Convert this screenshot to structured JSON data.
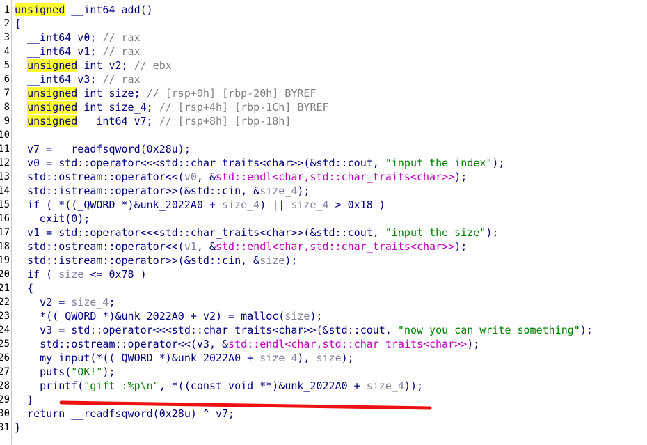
{
  "lines": [
    {
      "n": "1",
      "tokens": [
        {
          "t": "unsigned",
          "c": "t hl"
        },
        {
          "t": " __int64 add()",
          "c": "t"
        }
      ]
    },
    {
      "n": "2",
      "tokens": [
        {
          "t": "{",
          "c": "t"
        }
      ]
    },
    {
      "n": "3",
      "tokens": [
        {
          "t": "  __int64 v0; ",
          "c": "t"
        },
        {
          "t": "// rax",
          "c": "cm"
        }
      ]
    },
    {
      "n": "4",
      "tokens": [
        {
          "t": "  __int64 v1; ",
          "c": "t"
        },
        {
          "t": "// rax",
          "c": "cm"
        }
      ]
    },
    {
      "n": "5",
      "tokens": [
        {
          "t": "  ",
          "c": "t"
        },
        {
          "t": "unsigned",
          "c": "t hl"
        },
        {
          "t": " int v2; ",
          "c": "t"
        },
        {
          "t": "// ebx",
          "c": "cm"
        }
      ]
    },
    {
      "n": "6",
      "tokens": [
        {
          "t": "  __int64 v3; ",
          "c": "t"
        },
        {
          "t": "// rax",
          "c": "cm"
        }
      ]
    },
    {
      "n": "7",
      "tokens": [
        {
          "t": "  ",
          "c": "t"
        },
        {
          "t": "unsigned",
          "c": "t hl"
        },
        {
          "t": " int size; ",
          "c": "t"
        },
        {
          "t": "// [rsp+0h] [rbp-20h] BYREF",
          "c": "cm"
        }
      ]
    },
    {
      "n": "8",
      "tokens": [
        {
          "t": "  ",
          "c": "t"
        },
        {
          "t": "unsigned",
          "c": "t hl"
        },
        {
          "t": " int size_4; ",
          "c": "t"
        },
        {
          "t": "// [rsp+4h] [rbp-1Ch] BYREF",
          "c": "cm"
        }
      ]
    },
    {
      "n": "9",
      "tokens": [
        {
          "t": "  ",
          "c": "t"
        },
        {
          "t": "unsigned",
          "c": "t hl"
        },
        {
          "t": " __int64 v7; ",
          "c": "t"
        },
        {
          "t": "// [rsp+8h] [rbp-18h]",
          "c": "cm"
        }
      ]
    },
    {
      "n": "10",
      "tokens": [
        {
          "t": "",
          "c": "t"
        }
      ]
    },
    {
      "n": "11",
      "tokens": [
        {
          "t": "  v7 = __readfsqword(0x28u);",
          "c": "t"
        }
      ]
    },
    {
      "n": "12",
      "tokens": [
        {
          "t": "  v0 = std::operator<<<std::char_traits<char>>(&std::cout, ",
          "c": "t"
        },
        {
          "t": "\"input the index\"",
          "c": "st"
        },
        {
          "t": ");",
          "c": "t"
        }
      ]
    },
    {
      "n": "13",
      "tokens": [
        {
          "t": "  std::ostream::operator<<(",
          "c": "t"
        },
        {
          "t": "v0",
          "c": "vr"
        },
        {
          "t": ", &",
          "c": "t"
        },
        {
          "t": "std::endl<char,std::char_traits<char>>",
          "c": "lib"
        },
        {
          "t": ");",
          "c": "t"
        }
      ]
    },
    {
      "n": "14",
      "tokens": [
        {
          "t": "  std::istream::operator>>(&std::cin, &",
          "c": "t"
        },
        {
          "t": "size_4",
          "c": "vr"
        },
        {
          "t": ");",
          "c": "t"
        }
      ]
    },
    {
      "n": "15",
      "tokens": [
        {
          "t": "  if ( *((_QWORD *)&unk_2022A0 + ",
          "c": "t"
        },
        {
          "t": "size_4",
          "c": "vr"
        },
        {
          "t": ") || ",
          "c": "t"
        },
        {
          "t": "size_4",
          "c": "vr"
        },
        {
          "t": " > 0x18 )",
          "c": "t"
        }
      ]
    },
    {
      "n": "16",
      "tokens": [
        {
          "t": "    exit(0);",
          "c": "t"
        }
      ]
    },
    {
      "n": "17",
      "tokens": [
        {
          "t": "  v1 = std::operator<<<std::char_traits<char>>(&std::cout, ",
          "c": "t"
        },
        {
          "t": "\"input the size\"",
          "c": "st"
        },
        {
          "t": ");",
          "c": "t"
        }
      ]
    },
    {
      "n": "18",
      "tokens": [
        {
          "t": "  std::ostream::operator<<(",
          "c": "t"
        },
        {
          "t": "v1",
          "c": "vr"
        },
        {
          "t": ", &",
          "c": "t"
        },
        {
          "t": "std::endl<char,std::char_traits<char>>",
          "c": "lib"
        },
        {
          "t": ");",
          "c": "t"
        }
      ]
    },
    {
      "n": "19",
      "tokens": [
        {
          "t": "  std::istream::operator>>(&std::cin, &",
          "c": "t"
        },
        {
          "t": "size",
          "c": "vr"
        },
        {
          "t": ");",
          "c": "t"
        }
      ]
    },
    {
      "n": "20",
      "tokens": [
        {
          "t": "  if ( ",
          "c": "t"
        },
        {
          "t": "size",
          "c": "vr"
        },
        {
          "t": " <= 0x78 )",
          "c": "t"
        }
      ]
    },
    {
      "n": "21",
      "tokens": [
        {
          "t": "  {",
          "c": "t"
        }
      ]
    },
    {
      "n": "22",
      "tokens": [
        {
          "t": "    v2 = ",
          "c": "t"
        },
        {
          "t": "size_4",
          "c": "vr"
        },
        {
          "t": ";",
          "c": "t"
        }
      ]
    },
    {
      "n": "23",
      "tokens": [
        {
          "t": "    *((_QWORD *)&unk_2022A0 + v2) = malloc(",
          "c": "t"
        },
        {
          "t": "size",
          "c": "vr"
        },
        {
          "t": ");",
          "c": "t"
        }
      ]
    },
    {
      "n": "24",
      "tokens": [
        {
          "t": "    v3 = std::operator<<<std::char_traits<char>>(&std::cout, ",
          "c": "t"
        },
        {
          "t": "\"now you can write something\"",
          "c": "st"
        },
        {
          "t": ");",
          "c": "t"
        }
      ]
    },
    {
      "n": "25",
      "tokens": [
        {
          "t": "    std::ostream::operator<<(v3, &",
          "c": "t"
        },
        {
          "t": "std::endl<char,std::char_traits<char>>",
          "c": "lib"
        },
        {
          "t": ");",
          "c": "t"
        }
      ]
    },
    {
      "n": "26",
      "tokens": [
        {
          "t": "    my_input(*((_QWORD *)&unk_2022A0 + ",
          "c": "t"
        },
        {
          "t": "size_4",
          "c": "vr"
        },
        {
          "t": "), ",
          "c": "t"
        },
        {
          "t": "size",
          "c": "vr"
        },
        {
          "t": ");",
          "c": "t"
        }
      ]
    },
    {
      "n": "27",
      "tokens": [
        {
          "t": "    puts(",
          "c": "t"
        },
        {
          "t": "\"OK!\"",
          "c": "st"
        },
        {
          "t": ");",
          "c": "t"
        }
      ]
    },
    {
      "n": "28",
      "tokens": [
        {
          "t": "    printf(",
          "c": "t"
        },
        {
          "t": "\"gift :%p\\n\"",
          "c": "st"
        },
        {
          "t": ", *((const void **)&unk_2022A0 + ",
          "c": "t"
        },
        {
          "t": "size_4",
          "c": "vr"
        },
        {
          "t": "));",
          "c": "t"
        }
      ]
    },
    {
      "n": "29",
      "tokens": [
        {
          "t": "  }",
          "c": "t"
        }
      ]
    },
    {
      "n": "30",
      "tokens": [
        {
          "t": "  return __readfsqword(0x28u) ^ v7;",
          "c": "t"
        }
      ]
    },
    {
      "n": "31",
      "tokens": [
        {
          "t": "}",
          "c": "t"
        }
      ]
    }
  ],
  "colors": {
    "keyword_highlight": "#ffff33",
    "code": "#000080",
    "comment": "#808080",
    "string": "#008000",
    "library": "#c000c0",
    "variable": "#8080a0",
    "annotation_underline": "#ee1111"
  }
}
